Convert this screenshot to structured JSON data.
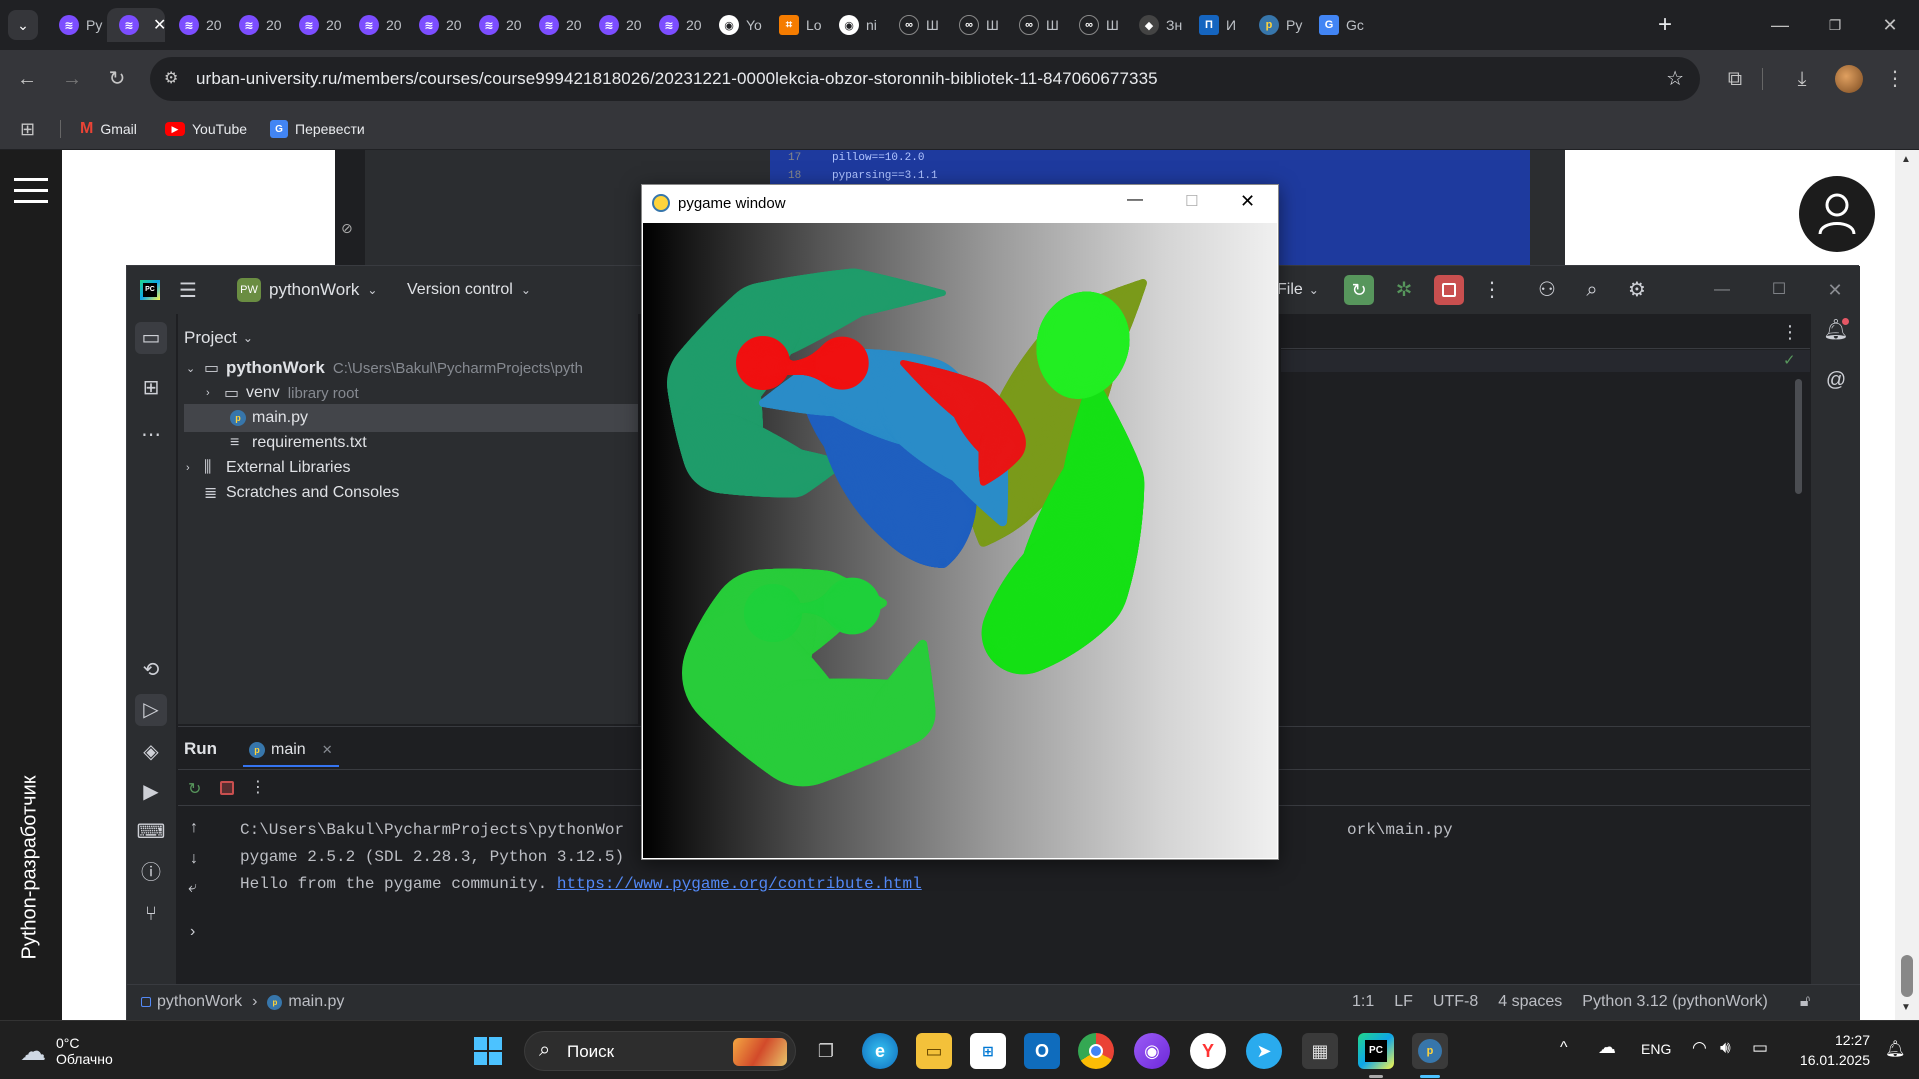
{
  "browser": {
    "tabs": [
      {
        "label": "Py",
        "icon": "urban-icon",
        "active": false
      },
      {
        "label": "",
        "icon": "urban-icon",
        "active": true
      },
      {
        "label": "20",
        "icon": "urban-icon"
      },
      {
        "label": "20",
        "icon": "urban-icon"
      },
      {
        "label": "20",
        "icon": "urban-icon"
      },
      {
        "label": "20",
        "icon": "urban-icon"
      },
      {
        "label": "20",
        "icon": "urban-icon"
      },
      {
        "label": "20",
        "icon": "urban-icon"
      },
      {
        "label": "20",
        "icon": "urban-icon"
      },
      {
        "label": "20",
        "icon": "urban-icon"
      },
      {
        "label": "20",
        "icon": "urban-icon"
      },
      {
        "label": "Yo",
        "icon": "github-icon"
      },
      {
        "label": "Lo",
        "icon": "orange-icon"
      },
      {
        "label": "ni",
        "icon": "github-icon"
      },
      {
        "label": "Ш",
        "icon": "link-icon"
      },
      {
        "label": "Ш",
        "icon": "link-icon"
      },
      {
        "label": "Ш",
        "icon": "link-icon"
      },
      {
        "label": "Ш",
        "icon": "link-icon"
      },
      {
        "label": "Зн",
        "icon": "dark-icon"
      },
      {
        "label": "И",
        "icon": "blue-icon"
      },
      {
        "label": "Py",
        "icon": "python-icon"
      },
      {
        "label": "Gc",
        "icon": "translate-icon"
      }
    ],
    "url": "urban-university.ru/members/courses/course999421818026/20231221-0000lekcia-obzor-storonnih-bibliotek-11-847060677335",
    "bookmarks": [
      {
        "label": "Gmail"
      },
      {
        "label": "YouTube"
      },
      {
        "label": "Перевести"
      }
    ],
    "sidebar_text": "Python-разработчик"
  },
  "bg_code": {
    "lines": [
      {
        "num": "17",
        "text": "pillow==10.2.0"
      },
      {
        "num": "18",
        "text": "pyparsing==3.1.1"
      }
    ]
  },
  "ide": {
    "logo": "PC",
    "project_badge": "PW",
    "project_name": "pythonWork",
    "vcs": "Version control",
    "file_menu": "File",
    "project_panel_title": "Project",
    "tree": [
      {
        "label": "pythonWork",
        "hint": "C:\\Users\\Bakul\\PycharmProjects\\pyth",
        "type": "folder",
        "expanded": true
      },
      {
        "label": "venv",
        "hint": "library root",
        "type": "folder",
        "expanded": false
      },
      {
        "label": "main.py",
        "hint": "",
        "type": "python",
        "selected": true
      },
      {
        "label": "requirements.txt",
        "hint": "",
        "type": "text"
      },
      {
        "label": "External Libraries",
        "hint": "",
        "type": "library"
      },
      {
        "label": "Scratches and Consoles",
        "hint": "",
        "type": "scratch"
      }
    ],
    "run": {
      "title": "Run",
      "tab": "main",
      "console": [
        {
          "text": "C:\\Users\\Bakul\\PycharmProjects\\pythonWor",
          "tail": "ork\\main.py"
        },
        {
          "text": "pygame 2.5.2 (SDL 2.28.3, Python 3.12.5)"
        },
        {
          "text": "Hello from the pygame community. ",
          "link": "https://www.pygame.org/contribute.html"
        }
      ]
    },
    "status": {
      "breadcrumb_project": "pythonWork",
      "breadcrumb_file": "main.py",
      "position": "1:1",
      "line_sep": "LF",
      "encoding": "UTF-8",
      "indent": "4 spaces",
      "interpreter": "Python 3.12 (pythonWork)"
    }
  },
  "pygame": {
    "title": "pygame window"
  },
  "taskbar": {
    "weather_temp": "0°C",
    "weather_desc": "Облачно",
    "search_placeholder": "Поиск",
    "lang": "ENG",
    "time": "12:27",
    "date": "16.01.2025"
  },
  "colors": {
    "chrome_dark": "#202124",
    "chrome_toolbar": "#35363a",
    "ide_bg": "#1e1f22",
    "ide_panel": "#2b2d30",
    "link": "#548af7",
    "accent_green": "#57965c"
  }
}
